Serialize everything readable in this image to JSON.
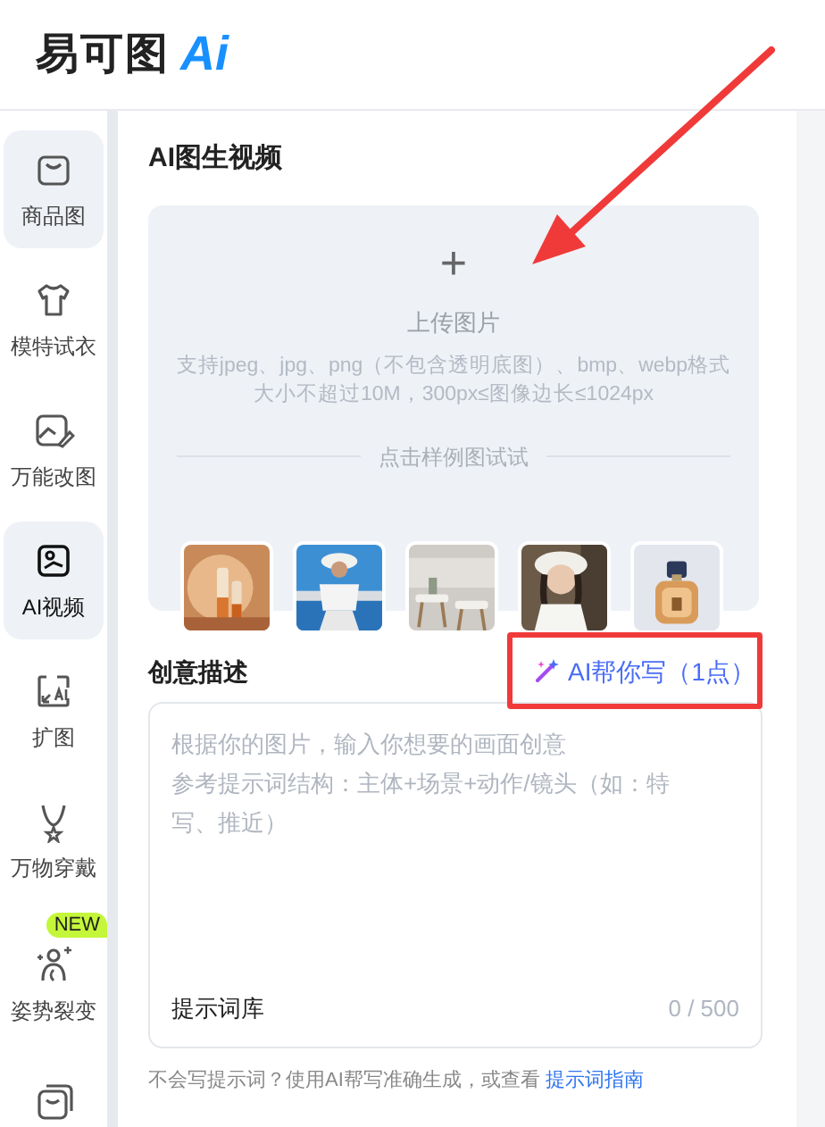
{
  "header": {
    "logo_text": "易可图",
    "logo_mark": "Ai"
  },
  "sidebar": {
    "items": [
      {
        "label": "商品图",
        "selected": false,
        "highlighted": true
      },
      {
        "label": "模特试衣",
        "selected": false,
        "highlighted": false
      },
      {
        "label": "万能改图",
        "selected": false,
        "highlighted": false
      },
      {
        "label": "AI视频",
        "selected": true,
        "highlighted": true
      },
      {
        "label": "扩图",
        "selected": false,
        "highlighted": false
      },
      {
        "label": "万物穿戴",
        "selected": false,
        "highlighted": false
      },
      {
        "label": "姿势裂变",
        "selected": false,
        "highlighted": false,
        "badge": "NEW"
      },
      {
        "selected": false,
        "highlighted": false
      }
    ]
  },
  "panel": {
    "title": "AI图生视频",
    "upload": {
      "plus": "+",
      "label": "上传图片",
      "hint": "支持jpeg、jpg、png（不包含透明底图）、bmp、webp格式大小不超过10M，300px≤图像边长≤1024px",
      "samples_label": "点击样例图试试"
    },
    "prompt": {
      "label": "创意描述",
      "ai_button": "AI帮你写（1点）",
      "placeholder_lines": [
        "根据你的图片，输入你想要的画面创意",
        "参考提示词结构：主体+场景+动作/镜头（如：特写、推近）"
      ],
      "library_button": "提示词库",
      "counter": "0 / 500"
    },
    "footer_note": "不会写提示词？使用AI帮写准确生成，或查看",
    "footer_link": "提示词指南"
  },
  "annotation_arrow": true,
  "highlight_box": true
}
